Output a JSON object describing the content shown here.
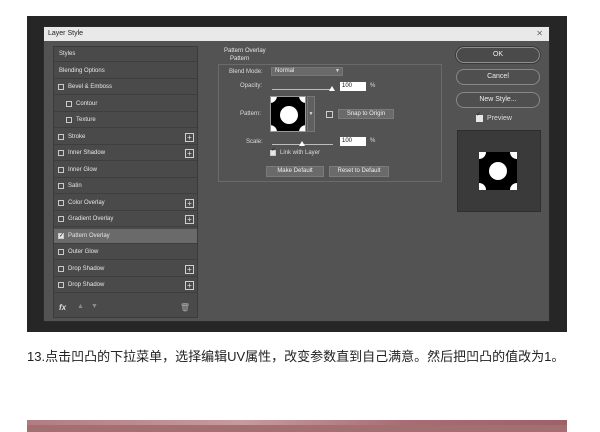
{
  "dialog": {
    "title": "Layer Style"
  },
  "styles_panel": {
    "items": [
      {
        "label": "Styles",
        "checkbox": false,
        "checked": false,
        "plus": false,
        "indent": false,
        "selected": false
      },
      {
        "label": "Blending Options",
        "checkbox": false,
        "checked": false,
        "plus": false,
        "indent": false,
        "selected": false
      },
      {
        "label": "Bevel & Emboss",
        "checkbox": true,
        "checked": false,
        "plus": false,
        "indent": false,
        "selected": false
      },
      {
        "label": "Contour",
        "checkbox": true,
        "checked": false,
        "plus": false,
        "indent": true,
        "selected": false
      },
      {
        "label": "Texture",
        "checkbox": true,
        "checked": false,
        "plus": false,
        "indent": true,
        "selected": false
      },
      {
        "label": "Stroke",
        "checkbox": true,
        "checked": false,
        "plus": true,
        "indent": false,
        "selected": false
      },
      {
        "label": "Inner Shadow",
        "checkbox": true,
        "checked": false,
        "plus": true,
        "indent": false,
        "selected": false
      },
      {
        "label": "Inner Glow",
        "checkbox": true,
        "checked": false,
        "plus": false,
        "indent": false,
        "selected": false
      },
      {
        "label": "Satin",
        "checkbox": true,
        "checked": false,
        "plus": false,
        "indent": false,
        "selected": false
      },
      {
        "label": "Color Overlay",
        "checkbox": true,
        "checked": false,
        "plus": true,
        "indent": false,
        "selected": false
      },
      {
        "label": "Gradient Overlay",
        "checkbox": true,
        "checked": false,
        "plus": true,
        "indent": false,
        "selected": false
      },
      {
        "label": "Pattern Overlay",
        "checkbox": true,
        "checked": true,
        "plus": false,
        "indent": false,
        "selected": true
      },
      {
        "label": "Outer Glow",
        "checkbox": true,
        "checked": false,
        "plus": false,
        "indent": false,
        "selected": false
      },
      {
        "label": "Drop Shadow",
        "checkbox": true,
        "checked": false,
        "plus": true,
        "indent": false,
        "selected": false
      },
      {
        "label": "Drop Shadow",
        "checkbox": true,
        "checked": false,
        "plus": true,
        "indent": false,
        "selected": false
      }
    ],
    "fx_label": "fx"
  },
  "pattern_overlay": {
    "section_title": "Pattern Overlay",
    "group_title": "Pattern",
    "blend_mode_label": "Blend Mode:",
    "blend_mode_value": "Normal",
    "opacity_label": "Opacity:",
    "opacity_value": "100",
    "opacity_unit": "%",
    "pattern_label": "Pattern:",
    "snap_button": "Snap to Origin",
    "scale_label": "Scale:",
    "scale_value": "100",
    "scale_unit": "%",
    "link_label": "Link with Layer",
    "link_checked": true,
    "make_default": "Make Default",
    "reset_default": "Reset to Default"
  },
  "buttons": {
    "ok": "OK",
    "cancel": "Cancel",
    "new_style": "New Style..."
  },
  "preview": {
    "label": "Preview",
    "checked": true
  },
  "caption": {
    "text": "13.点击凹凸的下拉菜单，选择编辑UV属性，改变参数直到自己满意。然后把凹凸的值改为1。"
  },
  "icons": {
    "fx": "fx-icon",
    "up": "arrow-up-icon",
    "down": "arrow-down-icon",
    "trash": "trash-icon",
    "snap": "new-preset-icon"
  }
}
